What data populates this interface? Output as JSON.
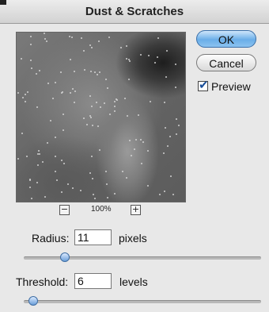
{
  "window": {
    "title": "Dust & Scratches"
  },
  "preview": {
    "zoom_label": "100%",
    "zoom_out": "−",
    "zoom_in": "+"
  },
  "buttons": {
    "ok_label": "OK",
    "cancel_label": "Cancel"
  },
  "preview_toggle": {
    "label": "Preview",
    "checked": true,
    "check_glyph": "✔"
  },
  "radius": {
    "label": "Radius:",
    "value": "11",
    "unit": "pixels",
    "slider_position": 0.16
  },
  "threshold": {
    "label": "Threshold:",
    "value": "6",
    "unit": "levels",
    "slider_position": 0.02
  },
  "colors": {
    "ok_button": "#6aaee8",
    "slider_thumb": "#6a9ed8",
    "dialog_bg": "#e8e8e8"
  }
}
